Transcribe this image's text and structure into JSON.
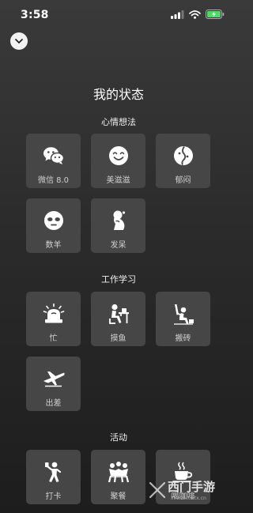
{
  "status_bar": {
    "time": "3:58"
  },
  "page_title": "我的状态",
  "sections": {
    "mood": {
      "title": "心情想法",
      "items": [
        {
          "label": "微信 8.0",
          "icon": "wechat-icon"
        },
        {
          "label": "美滋滋",
          "icon": "smile-face-icon"
        },
        {
          "label": "郁闷",
          "icon": "gloomy-icon"
        },
        {
          "label": "数羊",
          "icon": "sleepy-face-icon"
        },
        {
          "label": "发呆",
          "icon": "daze-figure-icon"
        }
      ]
    },
    "work": {
      "title": "工作学习",
      "items": [
        {
          "label": "忙",
          "icon": "busy-alarm-icon"
        },
        {
          "label": "摸鱼",
          "icon": "slacking-icon"
        },
        {
          "label": "搬砖",
          "icon": "moving-bricks-icon"
        },
        {
          "label": "出差",
          "icon": "airplane-icon"
        }
      ]
    },
    "activity": {
      "title": "活动",
      "items": [
        {
          "label": "打卡",
          "icon": "check-in-icon"
        },
        {
          "label": "聚餐",
          "icon": "dinner-party-icon"
        },
        {
          "label": "喝咖啡",
          "icon": "coffee-cup-icon"
        }
      ]
    }
  },
  "watermark": {
    "text": "西门手游",
    "url": "ximen.xmtx.cn"
  }
}
